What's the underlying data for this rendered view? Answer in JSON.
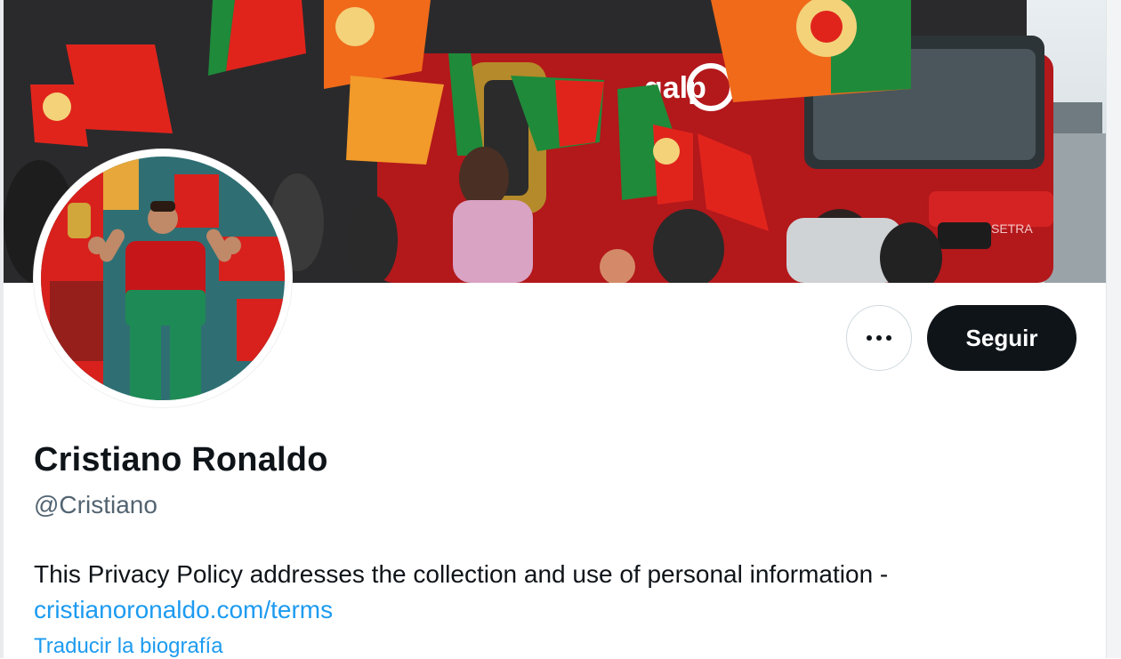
{
  "profile": {
    "name": "Cristiano Ronaldo",
    "handle": "@Cristiano",
    "bio_text": "This Privacy Policy addresses the collection and use of personal information -",
    "bio_link": "cristianoronaldo.com/terms",
    "translate_label": "Traducir la biografía"
  },
  "actions": {
    "follow_label": "Seguir",
    "more_icon": "more-horizontal-icon"
  },
  "banner": {
    "bus_brand": "galp",
    "bus_model": "SETRA"
  },
  "colors": {
    "follow_bg": "#0f1419",
    "link": "#1d9bf0",
    "handle": "#536471",
    "portugal_red": "#e0241c",
    "portugal_green": "#1f8a3a"
  }
}
